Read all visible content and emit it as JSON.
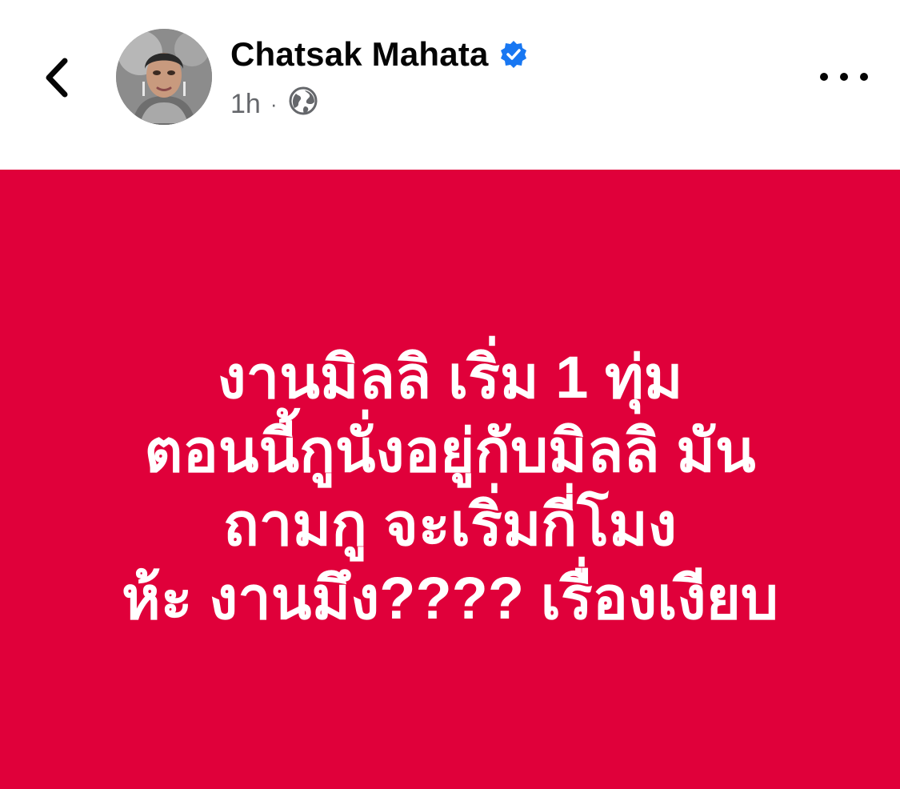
{
  "post_header": {
    "author_name": "Chatsak Mahata",
    "timestamp": "1h",
    "separator": "·",
    "privacy_icon": "globe-icon",
    "verified_icon": "verified-badge-icon",
    "back_icon": "chevron-left-icon",
    "more_icon": "more-horizontal-icon"
  },
  "post": {
    "background_color": "#e0003a",
    "text_color": "#ffffff",
    "lines": [
      "งานมิลลิ เริ่ม 1 ทุ่ม",
      "ตอนนี้กูนั่งอยู่กับมิลลิ มัน",
      "ถามกู จะเริ่มกี่โมง",
      "ห้ะ งานมึง???? เรื่องเงียบ"
    ]
  },
  "colors": {
    "verified_blue": "#1877f2",
    "meta_gray": "#65676b"
  }
}
